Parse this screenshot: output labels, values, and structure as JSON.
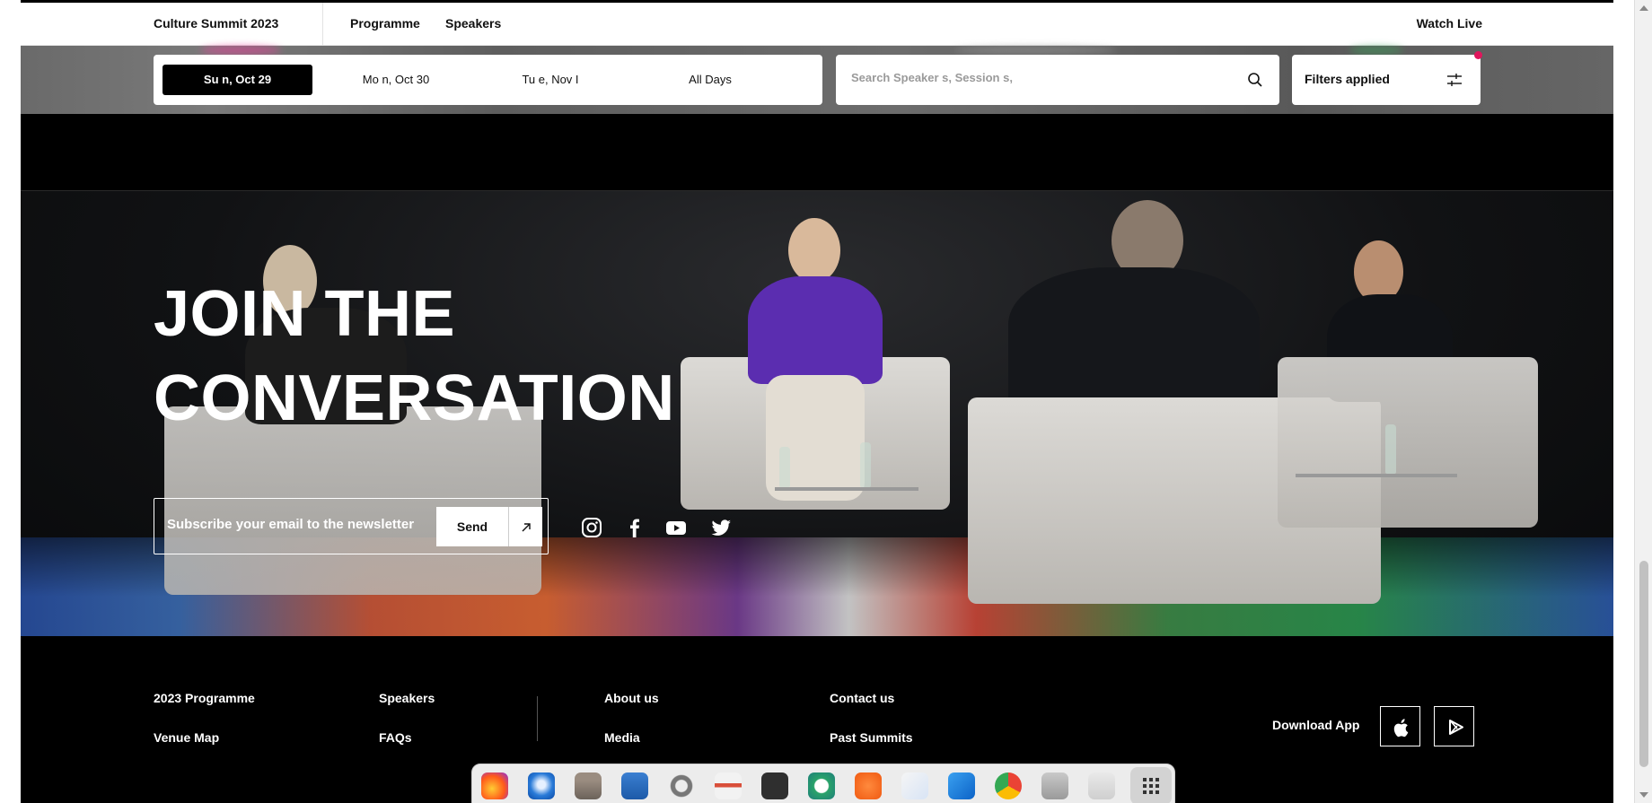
{
  "nav": {
    "brand": "Culture Summit 2023",
    "programme": "Programme",
    "speakers": "Speakers",
    "watch_live": "Watch Live"
  },
  "dates": {
    "days": [
      {
        "label": "Su n, Oct 29",
        "active": true
      },
      {
        "label": "Mo n, Oct 30",
        "active": false
      },
      {
        "label": "Tu e, Nov I",
        "active": false
      },
      {
        "label": "All Days",
        "active": false
      }
    ]
  },
  "search": {
    "placeholder": "Search Speaker s, Session s,"
  },
  "filters": {
    "label": "Filters applied"
  },
  "hero": {
    "title_line1": "JOIN THE",
    "title_line2": "CONVERSATION"
  },
  "newsletter": {
    "placeholder": "Subscribe your email to the newsletter",
    "send_label": "Send"
  },
  "social": [
    "instagram-icon",
    "facebook-icon",
    "youtube-icon",
    "twitter-icon"
  ],
  "footer": {
    "programme": "2023 Programme",
    "venue_map": "Venue Map",
    "speakers": "Speakers",
    "faqs": "FAQs",
    "about": "About us",
    "media": "Media",
    "contact": "Contact us",
    "past_summits": "Past Summits",
    "download_app": "Download App"
  },
  "dock": [
    "firefox",
    "thunderbird",
    "files",
    "writer",
    "settings",
    "impress",
    "terminal",
    "app-x",
    "inkscape",
    "text-editor",
    "vscode",
    "chrome",
    "image-viewer",
    "trash",
    "app-grid"
  ],
  "colors": {
    "accent": "#e0155c",
    "page_bg": "#000000",
    "nav_bg": "#ffffff"
  }
}
